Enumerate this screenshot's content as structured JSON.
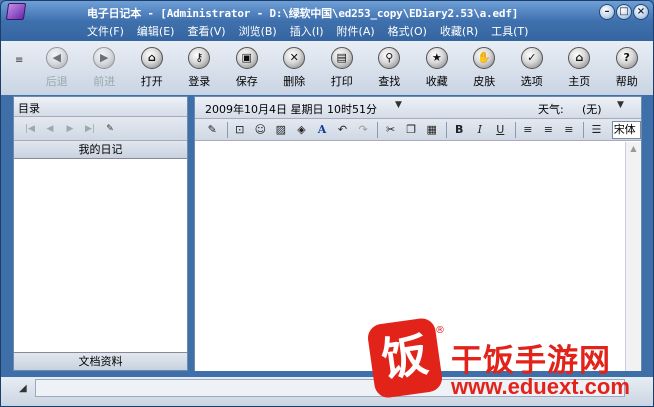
{
  "window": {
    "title": "电子日记本 - [Administrator - D:\\绿软中国\\ed253_copy\\EDiary2.53\\a.edf]"
  },
  "menu": [
    "文件(F)",
    "编辑(E)",
    "查看(V)",
    "浏览(B)",
    "插入(I)",
    "附件(A)",
    "格式(O)",
    "收藏(R)",
    "工具(T)"
  ],
  "toolbar": [
    {
      "label": "后退",
      "icon": "back-icon",
      "glyph": "◀",
      "enabled": false
    },
    {
      "label": "前进",
      "icon": "forward-icon",
      "glyph": "▶",
      "enabled": false
    },
    {
      "label": "打开",
      "icon": "open-icon",
      "glyph": "⌂",
      "enabled": true
    },
    {
      "label": "登录",
      "icon": "key-icon",
      "glyph": "⚷",
      "enabled": true
    },
    {
      "label": "保存",
      "icon": "save-icon",
      "glyph": "▣",
      "enabled": true
    },
    {
      "label": "删除",
      "icon": "delete-icon",
      "glyph": "✕",
      "enabled": true
    },
    {
      "label": "打印",
      "icon": "print-icon",
      "glyph": "▤",
      "enabled": true
    },
    {
      "label": "查找",
      "icon": "find-icon",
      "glyph": "⚲",
      "enabled": true
    },
    {
      "label": "收藏",
      "icon": "favorites-icon",
      "glyph": "★",
      "enabled": true
    },
    {
      "label": "皮肤",
      "icon": "skin-icon",
      "glyph": "✋",
      "enabled": true
    },
    {
      "label": "选项",
      "icon": "options-icon",
      "glyph": "✓",
      "enabled": true
    },
    {
      "label": "主页",
      "icon": "home-icon",
      "glyph": "⌂",
      "enabled": true
    },
    {
      "label": "帮助",
      "icon": "help-icon",
      "glyph": "?",
      "enabled": true
    }
  ],
  "left_panel": {
    "header": "目录",
    "diary_section": "我的日记",
    "docs_section": "文档资料"
  },
  "right_panel": {
    "date": "2009年10月4日  星期日  10时51分",
    "weather_label": "天气:",
    "weather_value": "(无)",
    "font": "宋体"
  },
  "watermark": {
    "name": "干饭手游网",
    "url": "www.eduext.com",
    "logo_char": "饭",
    "reg": "®"
  }
}
